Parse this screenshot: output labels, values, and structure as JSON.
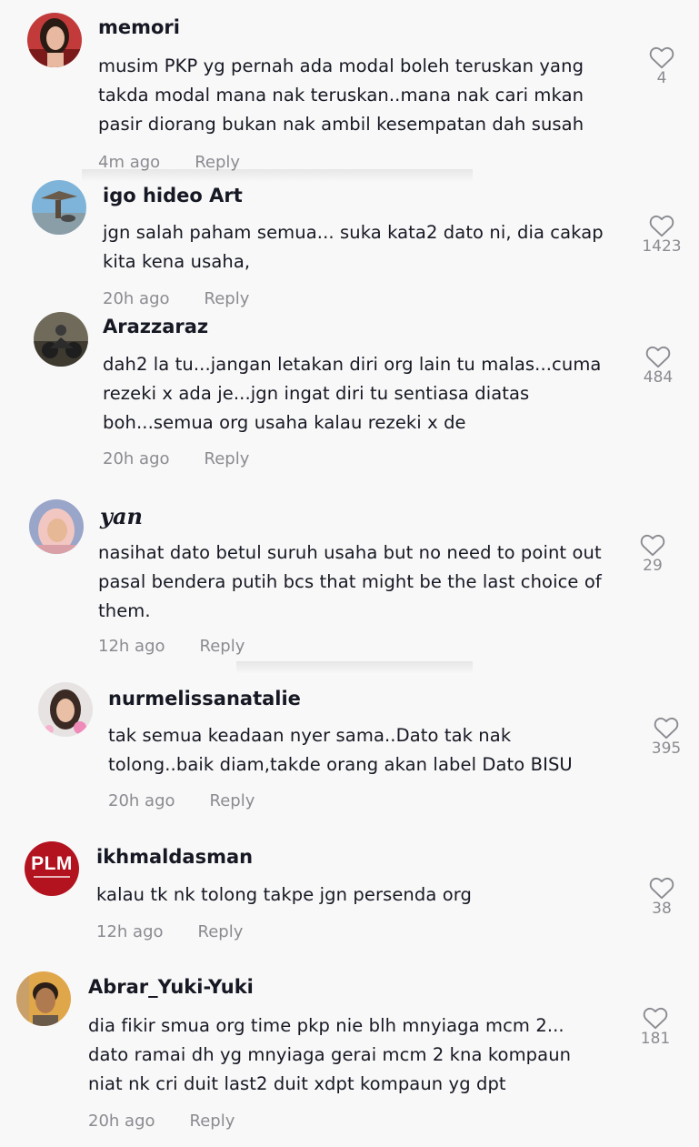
{
  "comments": [
    {
      "username": "memori",
      "lines": [
        "musim PKP yg pernah ada modal boleh teruskan yang",
        "takda modal mana nak teruskan..mana nak cari mkan",
        "pasir diorang bukan nak ambil kesempatan dah susah"
      ],
      "time": "4m ago",
      "reply": "Reply",
      "likes": "4",
      "avatar_icon": "profile-photo-woman"
    },
    {
      "username": "igo hideo Art",
      "lines": [
        "jgn salah paham semua... suka kata2 dato ni, dia cakap",
        "kita kena usaha,"
      ],
      "time": "20h ago",
      "reply": "Reply",
      "likes": "1423",
      "avatar_icon": "profile-photo-sky"
    },
    {
      "username": "Arazzaraz",
      "lines": [
        "dah2 la tu...jangan letakan diri org lain tu malas...cuma",
        "rezeki x ada je...jgn ingat diri tu sentiasa diatas",
        "boh...semua org usaha kalau rezeki x de"
      ],
      "time": "20h ago",
      "reply": "Reply",
      "likes": "484",
      "avatar_icon": "profile-photo-motorbike"
    },
    {
      "username": "yan",
      "lines": [
        "nasihat dato betul suruh usaha but no need to point out",
        "pasal bendera putih bcs that might be the last choice of",
        "them."
      ],
      "time": "12h ago",
      "reply": "Reply",
      "likes": "29",
      "avatar_icon": "profile-photo-hijab"
    },
    {
      "username": "nurmelissanatalie",
      "lines": [
        "tak semua keadaan nyer sama..Dato tak nak",
        "tolong..baik diam,takde orang akan label Dato BISU"
      ],
      "time": "20h ago",
      "reply": "Reply",
      "likes": "395",
      "avatar_icon": "profile-photo-girl"
    },
    {
      "username": "ikhmaldasman",
      "lines": [
        "kalau tk nk tolong takpe jgn persenda org"
      ],
      "time": "12h ago",
      "reply": "Reply",
      "likes": "38",
      "avatar_icon": "plm-logo",
      "logo_text": "PLM"
    },
    {
      "username": "Abrar_Yuki-Yuki",
      "lines": [
        "dia fikir smua org time pkp nie blh mnyiaga mcm 2...",
        "dato ramai dh yg mnyiaga gerai mcm 2 kna kompaun",
        "niat nk cri duit last2 duit xdpt kompaun yg dpt"
      ],
      "time": "20h ago",
      "reply": "Reply",
      "likes": "181",
      "avatar_icon": "profile-photo-man"
    }
  ],
  "colors": {
    "background": "#f8f8f8",
    "text": "#161823",
    "muted": "#8a8b91",
    "plm_red": "#b3121f"
  }
}
